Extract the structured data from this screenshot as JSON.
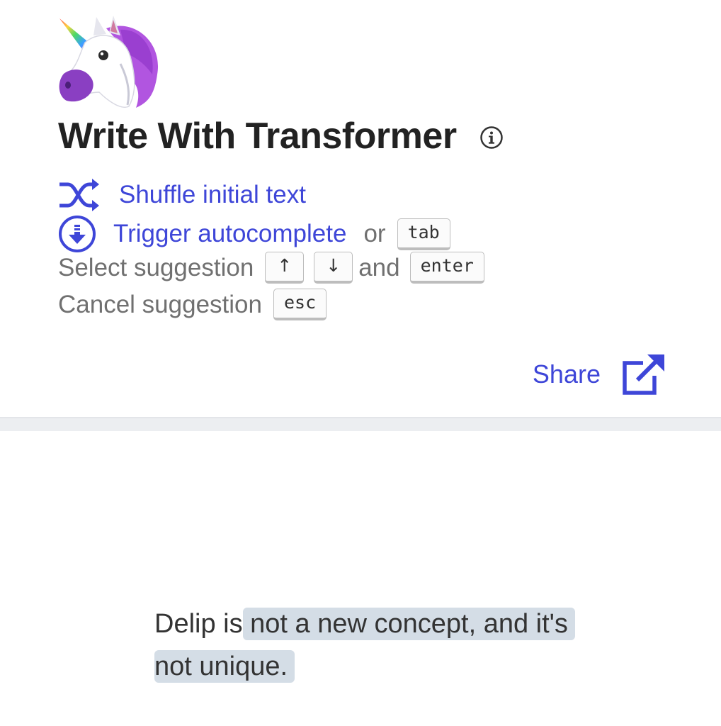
{
  "header": {
    "title": "Write With Transformer",
    "logo_icon": "unicorn-icon",
    "info_icon": "info-icon"
  },
  "controls": {
    "shuffle": {
      "label": "Shuffle initial text",
      "icon": "shuffle-icon"
    },
    "autocomplete": {
      "label": "Trigger autocomplete",
      "icon": "download-circle-icon",
      "or_text": "or",
      "key": "tab"
    },
    "select": {
      "label": "Select suggestion",
      "key_up": "↑",
      "key_down": "↓",
      "and_text": "and",
      "key_enter": "enter"
    },
    "cancel": {
      "label": "Cancel suggestion",
      "key": "esc"
    }
  },
  "share": {
    "label": "Share",
    "icon": "external-link-icon"
  },
  "editor": {
    "typed_text": "Delip is",
    "suggestion_text": " not a new concept, and it's not unique."
  },
  "colors": {
    "accent": "#3e46d8",
    "muted_text": "#707070",
    "suggestion_bg": "#d4dde6",
    "divider": "#eceef1"
  }
}
